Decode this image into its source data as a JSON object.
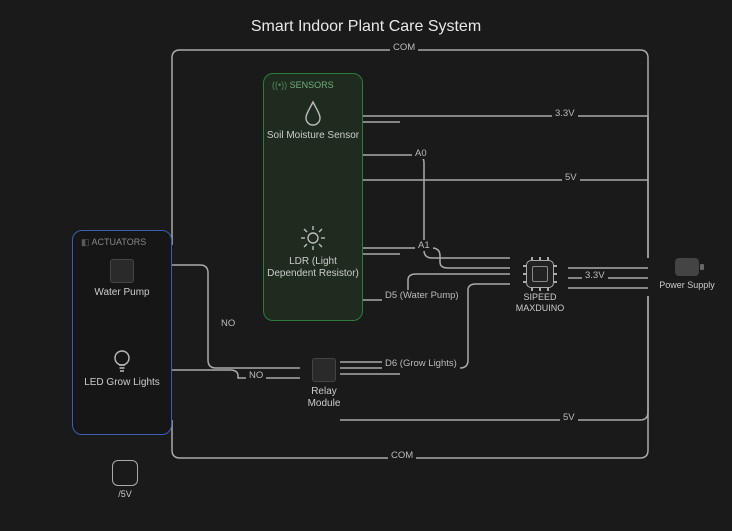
{
  "title": "Smart Indoor Plant Care System",
  "groups": {
    "actuators": {
      "label": "ACTUATORS"
    },
    "sensors": {
      "label": "SENSORS"
    }
  },
  "components": {
    "water_pump": "Water Pump",
    "led_lights": "LED Grow Lights",
    "soil_sensor": "Soil Moisture Sensor",
    "ldr": "LDR (Light Dependent Resistor)",
    "relay": "Relay Module",
    "mcu": "SIPEED MAXDUINO",
    "psu": "Power Supply",
    "orphan": "/5V"
  },
  "wires": {
    "com_top": "COM",
    "v33_top": "3.3V",
    "a0": "A0",
    "v5_upper": "5V",
    "a1": "A1",
    "v33_chip": "3.3V",
    "no_1": "NO",
    "no_2": "NO",
    "d5": "D5 (Water Pump)",
    "d6": "D6 (Grow Lights)",
    "v5_lower": "5V",
    "com_bottom": "COM"
  }
}
